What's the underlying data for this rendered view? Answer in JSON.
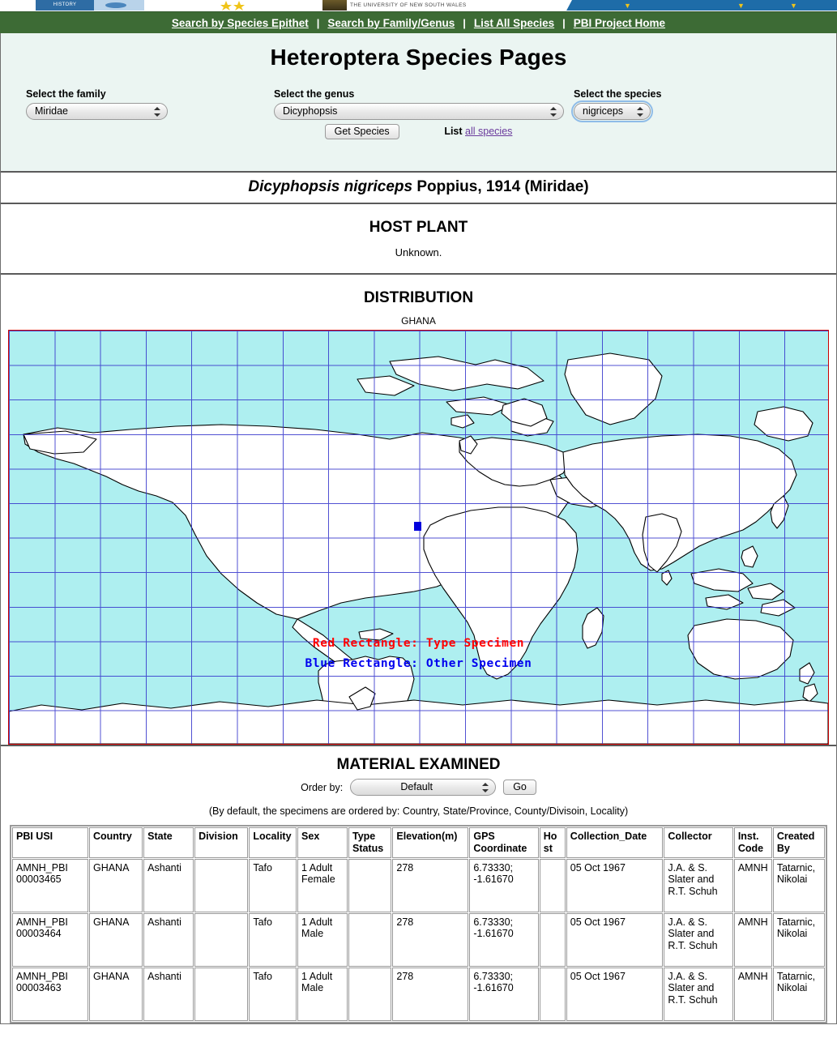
{
  "banner": {
    "amnh_text": "HISTORY",
    "unsw_text": "THE UNIVERSITY OF NEW SOUTH WALES"
  },
  "nav": {
    "items": [
      {
        "label": "Search by Species Epithet"
      },
      {
        "label": "Search by Family/Genus"
      },
      {
        "label": "List All Species"
      },
      {
        "label": "PBI Project Home"
      }
    ],
    "separator": "|"
  },
  "header": {
    "title": "Heteroptera Species Pages"
  },
  "selectors": {
    "family": {
      "label": "Select the family",
      "value": "Miridae"
    },
    "genus": {
      "label": "Select the genus",
      "value": "Dicyphopsis"
    },
    "species": {
      "label": "Select the species",
      "value": "nigriceps"
    },
    "get_species_button": "Get Species",
    "list_prefix": "List",
    "list_link": "all species"
  },
  "species": {
    "genus_species": "Dicyphopsis nigriceps",
    "author_year_family": " Poppius, 1914 (Miridae)"
  },
  "host_plant": {
    "heading": "HOST PLANT",
    "value": "Unknown."
  },
  "distribution": {
    "heading": "DISTRIBUTION",
    "country": "GHANA",
    "legend_red": "Red Rectangle: Type Specimen",
    "legend_blue": "Blue Rectangle: Other Specimen",
    "colors": {
      "ocean": "#aeeff0",
      "land": "#ffffff",
      "grid": "#3333cc",
      "border": "#cc0000",
      "marker": "#0000dd"
    }
  },
  "material": {
    "heading": "MATERIAL EXAMINED",
    "order_by_label": "Order by:",
    "order_by_value": "Default",
    "go_button": "Go",
    "note": "(By default, the specimens are ordered by: Country, State/Province, County/Divisoin, Locality)",
    "columns": [
      "PBI USI",
      "Country",
      "State",
      "Division",
      "Locality",
      "Sex",
      "Type Status",
      "Elevation(m)",
      "GPS Coordinate",
      "Host",
      "Collection_Date",
      "Collector",
      "Inst. Code",
      "Created By"
    ],
    "rows": [
      {
        "pbi_usi": "AMNH_PBI 00003465",
        "country": "GHANA",
        "state": "Ashanti",
        "division": "",
        "locality": "Tafo",
        "sex": "1 Adult Female",
        "type_status": "",
        "elevation": "278",
        "gps": "6.73330; -1.61670",
        "host": "",
        "collection_date": "05 Oct 1967",
        "collector": "J.A. & S. Slater and R.T. Schuh",
        "inst_code": "AMNH",
        "created_by": "Tatarnic, Nikolai"
      },
      {
        "pbi_usi": "AMNH_PBI 00003464",
        "country": "GHANA",
        "state": "Ashanti",
        "division": "",
        "locality": "Tafo",
        "sex": "1 Adult Male",
        "type_status": "",
        "elevation": "278",
        "gps": "6.73330; -1.61670",
        "host": "",
        "collection_date": "05 Oct 1967",
        "collector": "J.A. & S. Slater and R.T. Schuh",
        "inst_code": "AMNH",
        "created_by": "Tatarnic, Nikolai"
      },
      {
        "pbi_usi": "AMNH_PBI 00003463",
        "country": "GHANA",
        "state": "Ashanti",
        "division": "",
        "locality": "Tafo",
        "sex": "1 Adult Male",
        "type_status": "",
        "elevation": "278",
        "gps": "6.73330; -1.61670",
        "host": "",
        "collection_date": "05 Oct 1967",
        "collector": "J.A. & S. Slater and R.T. Schuh",
        "inst_code": "AMNH",
        "created_by": "Tatarnic, Nikolai"
      }
    ]
  }
}
